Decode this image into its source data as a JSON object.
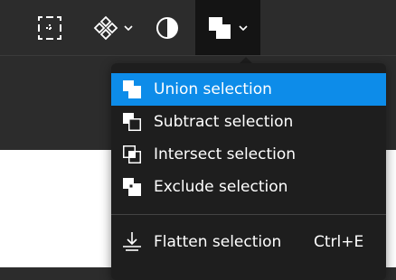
{
  "toolbar": {
    "tools": [
      {
        "icon": "frame-grid-icon"
      },
      {
        "icon": "components-icon",
        "has_dropdown": true
      },
      {
        "icon": "contrast-icon"
      },
      {
        "icon": "boolean-union-icon",
        "has_dropdown": true,
        "active": true
      }
    ]
  },
  "menu": {
    "items": [
      {
        "label": "Union selection",
        "icon": "union-icon",
        "selected": true
      },
      {
        "label": "Subtract selection",
        "icon": "subtract-icon"
      },
      {
        "label": "Intersect selection",
        "icon": "intersect-icon"
      },
      {
        "label": "Exclude selection",
        "icon": "exclude-icon"
      }
    ],
    "flatten": {
      "label": "Flatten selection",
      "shortcut": "Ctrl+E",
      "icon": "flatten-icon"
    }
  },
  "colors": {
    "toolbar_bg": "#2c2c2c",
    "active_tool_bg": "#141414",
    "menu_bg": "#1e1e1e",
    "selected_item": "#0d8ce9",
    "text": "#ffffff",
    "canvas": "#ffffff"
  }
}
